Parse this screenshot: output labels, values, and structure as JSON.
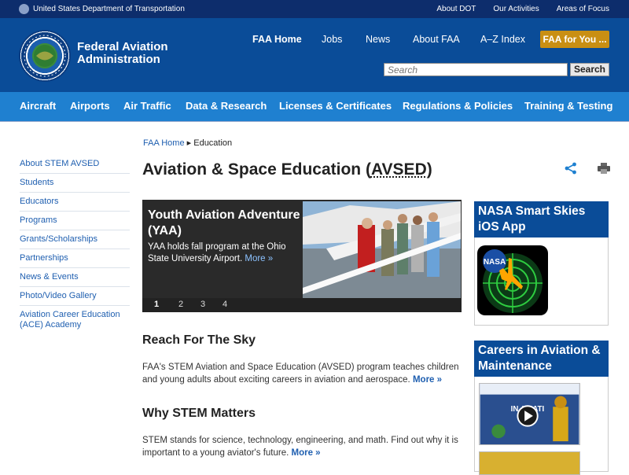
{
  "util": {
    "dot": "United States Department of Transportation",
    "links": [
      "About DOT",
      "Our Activities",
      "Areas of Focus"
    ]
  },
  "header": {
    "agency_line1": "Federal Aviation",
    "agency_line2": "Administration",
    "nav": {
      "home": "FAA Home",
      "jobs": "Jobs",
      "news": "News",
      "about": "About FAA",
      "az": "A–Z Index",
      "for_you": "FAA for You ..."
    },
    "search": {
      "placeholder": "Search",
      "button": "Search"
    }
  },
  "topic_nav": [
    "Aircraft",
    "Airports",
    "Air Traffic",
    "Data & Research",
    "Licenses & Certificates",
    "Regulations & Policies",
    "Training & Testing"
  ],
  "breadcrumb": {
    "home": "FAA Home",
    "separator": "▸",
    "current": "Education"
  },
  "left_nav": [
    "About STEM AVSED",
    "Students",
    "Educators",
    "Programs",
    "Grants/Scholarships",
    "Partnerships",
    "News & Events",
    "Photo/Video Gallery",
    "Aviation Career Education (ACE) Academy"
  ],
  "page": {
    "title_main": "Aviation & Space Education (",
    "title_abbr": "AVSED",
    "title_end": ")"
  },
  "slider": {
    "headline": "Youth Aviation Adventure (YAA)",
    "text": "YAA holds fall program at the Ohio State University Airport.",
    "more": "More »",
    "pages": [
      "1",
      "2",
      "3",
      "4"
    ],
    "active_page": "1"
  },
  "sections": {
    "reach": {
      "heading": "Reach For The Sky",
      "text": "FAA's STEM Aviation and Space Education (AVSED) program teaches children and young adults about exciting careers in aviation and aerospace.",
      "more": "More »"
    },
    "why": {
      "heading": "Why STEM Matters",
      "text": "STEM stands for science, technology, engineering, and math. Find out why it is important to a young aviator's future.",
      "more": "More »"
    }
  },
  "sidebar": {
    "nasa_title": "NASA Smart Skies iOS App",
    "nasa_icon_label": "NASA",
    "careers_title": "Careers in Aviation & Maintenance",
    "careers_thumb_text": "IN AVIATI"
  },
  "colors": {
    "util_bar": "#0d2d6c",
    "header": "#0a4c98",
    "topic_nav": "#1f80d0",
    "for_you": "#c98f13",
    "link": "#1f5fb0"
  }
}
